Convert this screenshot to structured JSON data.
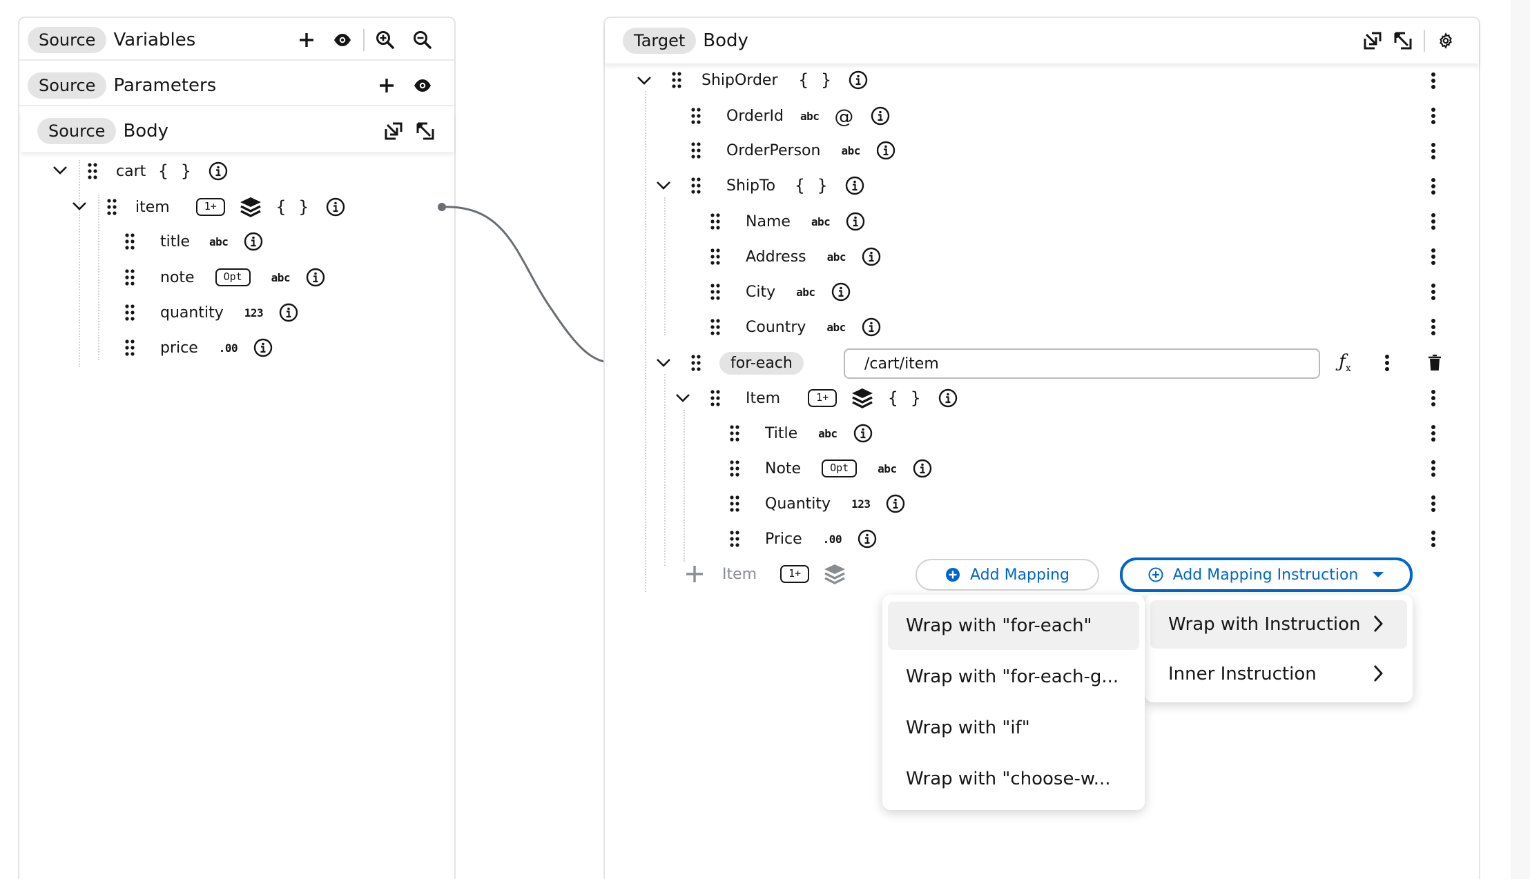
{
  "source": {
    "variables": {
      "chip": "Source",
      "title": "Variables"
    },
    "parameters": {
      "chip": "Source",
      "title": "Parameters"
    },
    "body": {
      "chip": "Source",
      "title": "Body"
    },
    "tree": {
      "cart": {
        "name": "cart",
        "braces": "{ }"
      },
      "item": {
        "name": "item",
        "badge": "1+",
        "braces": "{ }"
      },
      "fields": [
        {
          "name": "title",
          "type": "abc"
        },
        {
          "name": "note",
          "badge": "Opt",
          "type": "abc"
        },
        {
          "name": "quantity",
          "type": "123"
        },
        {
          "name": "price",
          "type": ".00"
        }
      ]
    }
  },
  "target": {
    "header": {
      "chip": "Target",
      "title": "Body"
    },
    "tree": {
      "shiporder": {
        "name": "ShipOrder",
        "braces": "{ }"
      },
      "orderid": {
        "name": "OrderId",
        "type": "abc",
        "attr": "@"
      },
      "orderperson": {
        "name": "OrderPerson",
        "type": "abc"
      },
      "shipto": {
        "name": "ShipTo",
        "braces": "{ }"
      },
      "shipto_fields": [
        {
          "name": "Name",
          "type": "abc"
        },
        {
          "name": "Address",
          "type": "abc"
        },
        {
          "name": "City",
          "type": "abc"
        },
        {
          "name": "Country",
          "type": "abc"
        }
      ],
      "foreach": {
        "label": "for-each",
        "expression": "/cart/item",
        "fx": "fx"
      },
      "item": {
        "name": "Item",
        "badge": "1+",
        "braces": "{ }"
      },
      "item_fields": [
        {
          "name": "Title",
          "type": "abc"
        },
        {
          "name": "Note",
          "badge": "Opt",
          "type": "abc"
        },
        {
          "name": "Quantity",
          "type": "123"
        },
        {
          "name": "Price",
          "type": ".00"
        }
      ],
      "ghost_item": {
        "name": "Item",
        "badge": "1+"
      }
    },
    "add_mapping_label": "Add Mapping",
    "add_instruction_label": "Add Mapping Instruction"
  },
  "menu": {
    "main": [
      {
        "label": "Wrap with Instruction"
      },
      {
        "label": "Inner Instruction"
      }
    ],
    "sub": [
      {
        "label": "Wrap with \"for-each\""
      },
      {
        "label": "Wrap with \"for-each-g..."
      },
      {
        "label": "Wrap with \"if\""
      },
      {
        "label": "Wrap with \"choose-w..."
      }
    ]
  },
  "colors": {
    "accent": "#0066cc",
    "chip": "#e4e4e4",
    "text": "#151515",
    "ghost": "#8a8d90"
  }
}
